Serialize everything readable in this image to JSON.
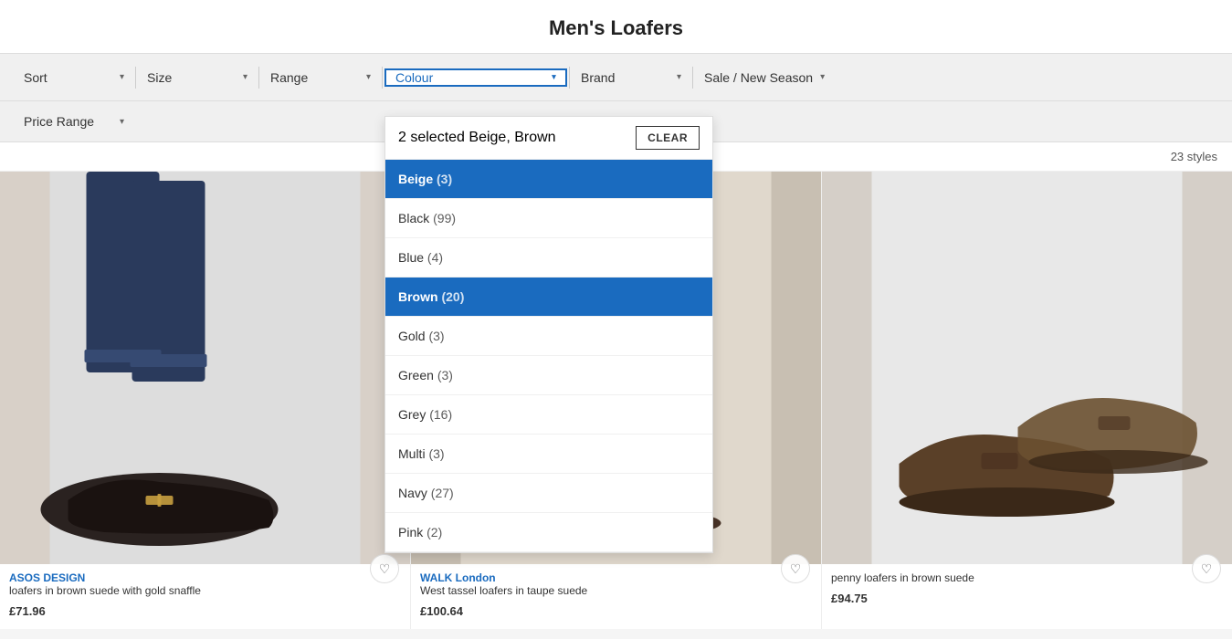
{
  "page": {
    "title": "Men's Loafers"
  },
  "filters": {
    "sort_label": "Sort",
    "size_label": "Size",
    "range_label": "Range",
    "colour_label": "Colour",
    "brand_label": "Brand",
    "sale_label": "Sale / New Season",
    "price_range_label": "Price Range"
  },
  "colour_dropdown": {
    "selected_count": "2 selected",
    "selected_names": "Beige, Brown",
    "clear_label": "CLEAR",
    "colours": [
      {
        "name": "Beige",
        "count": "(3)",
        "selected": true
      },
      {
        "name": "Black",
        "count": "(99)",
        "selected": false
      },
      {
        "name": "Blue",
        "count": "(4)",
        "selected": false
      },
      {
        "name": "Brown",
        "count": "(20)",
        "selected": true
      },
      {
        "name": "Gold",
        "count": "(3)",
        "selected": false
      },
      {
        "name": "Green",
        "count": "(3)",
        "selected": false
      },
      {
        "name": "Grey",
        "count": "(16)",
        "selected": false
      },
      {
        "name": "Multi",
        "count": "(3)",
        "selected": false
      },
      {
        "name": "Navy",
        "count": "(27)",
        "selected": false
      },
      {
        "name": "Pink",
        "count": "(2)",
        "selected": false
      }
    ]
  },
  "results": {
    "styles_count": "23 styles"
  },
  "products": [
    {
      "brand": "ASOS DESIGN",
      "description": "loafers in brown suede with gold snaffle",
      "price": "£71.96",
      "bg_color": "#d8d0c8"
    },
    {
      "brand": "WALK London",
      "description": "West tassel loafers in taupe suede",
      "price": "£100.64",
      "bg_color": "#c8bfb2"
    },
    {
      "brand": "",
      "description": "penny loafers in brown suede",
      "price": "£94.75",
      "bg_color": "#d5cfc8"
    }
  ],
  "icons": {
    "chevron_down": "▾",
    "chevron_up": "▴",
    "heart": "♡"
  }
}
